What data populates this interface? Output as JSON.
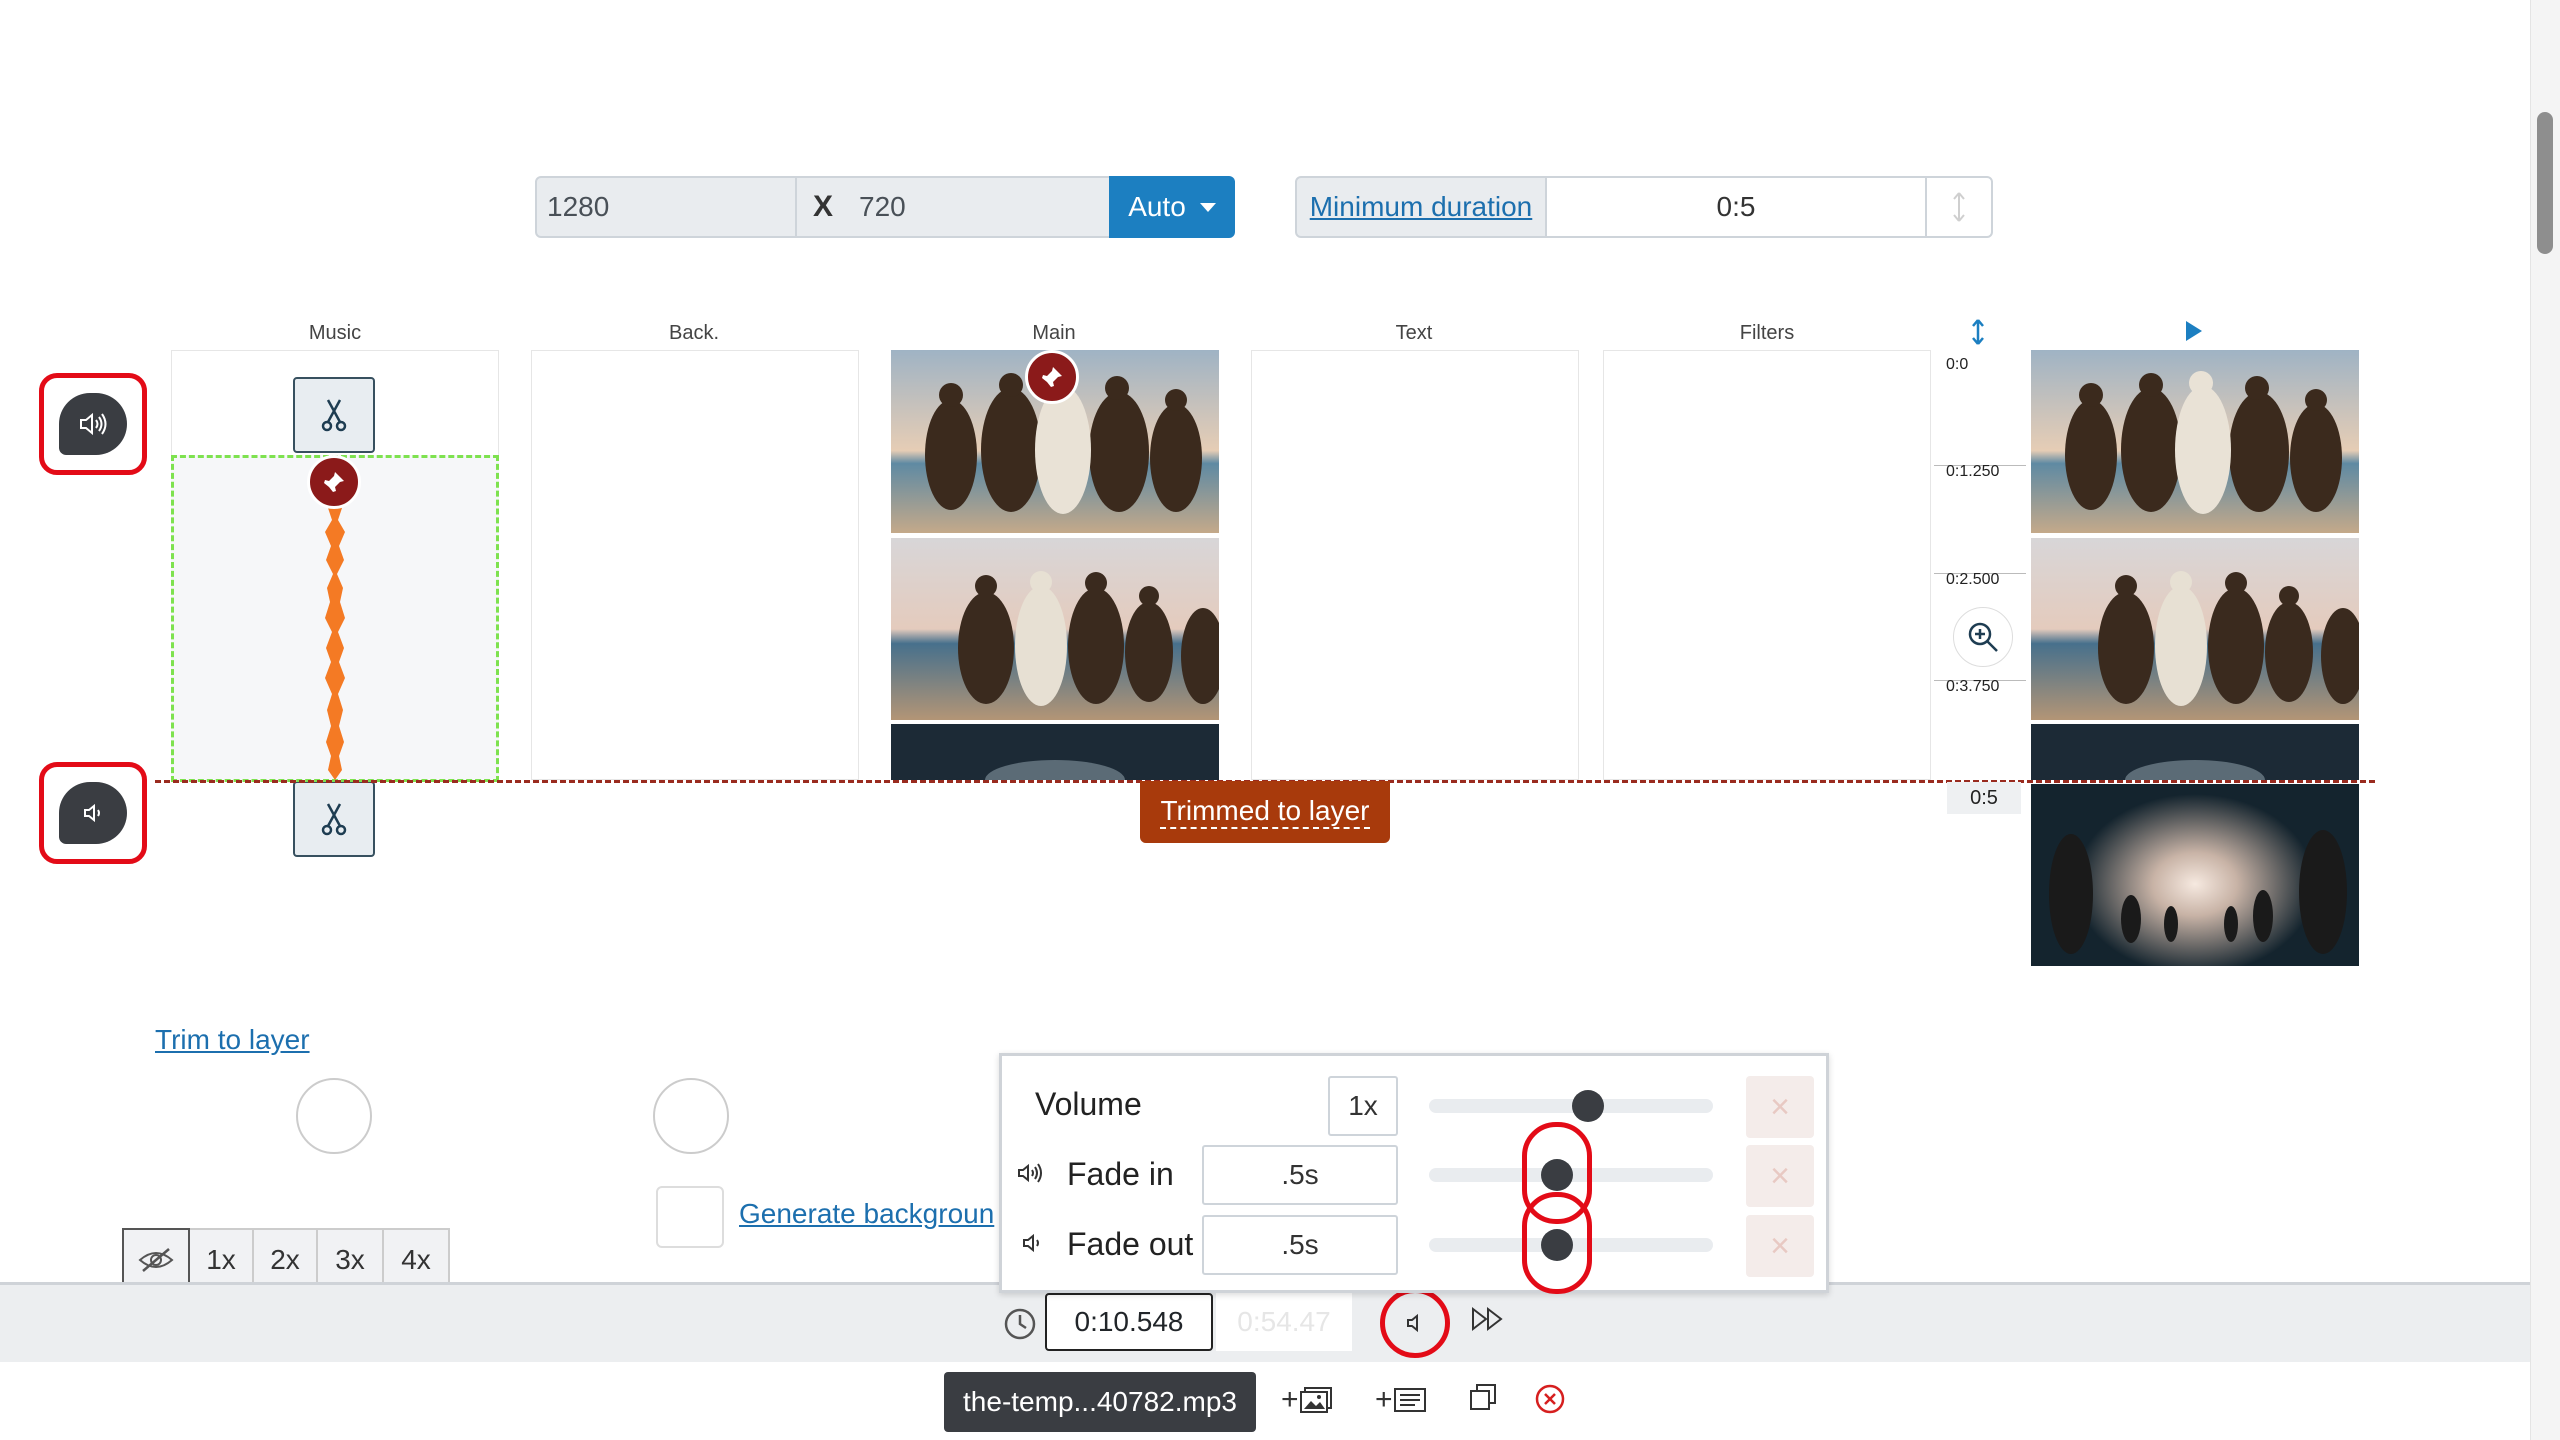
{
  "dimensions": {
    "width": "1280",
    "separator": "X",
    "height": "720",
    "mode_label": "Auto"
  },
  "duration": {
    "link_label": "Minimum duration",
    "value": "0:5",
    "stepper_icon": "vertical-arrows-icon"
  },
  "columns": [
    "Music",
    "Back.",
    "Main",
    "Text",
    "Filters"
  ],
  "ruler": {
    "ticks": [
      "0:0",
      "0:1.250",
      "0:2.500",
      "0:3.750"
    ],
    "end": "0:5"
  },
  "trimmed_badge": "Trimmed to layer",
  "trim_to_layer_link": "Trim to layer",
  "generate_background_link": "Generate backgroun",
  "speed_options": [
    "1x",
    "2x",
    "3x",
    "4x"
  ],
  "volume_panel": {
    "volume_label": "Volume",
    "volume_value": "1x",
    "volume_level": 0.56,
    "fade_in_label": "Fade in",
    "fade_in_value": ".5s",
    "fade_in_level": 0.45,
    "fade_out_label": "Fade out",
    "fade_out_value": ".5s",
    "fade_out_level": 0.45
  },
  "timer": {
    "current": "0:10.548",
    "total": "0:54.47"
  },
  "toolbar": {
    "audio_file": "the-temp...40782.mp3"
  },
  "colors": {
    "accent": "#1c7fc1",
    "highlight_ring": "#e30b17",
    "waveform": "#f47a24",
    "clip_border": "#7ee24f",
    "trim_line": "#9a2b1f",
    "badge": "#a83a0c"
  }
}
